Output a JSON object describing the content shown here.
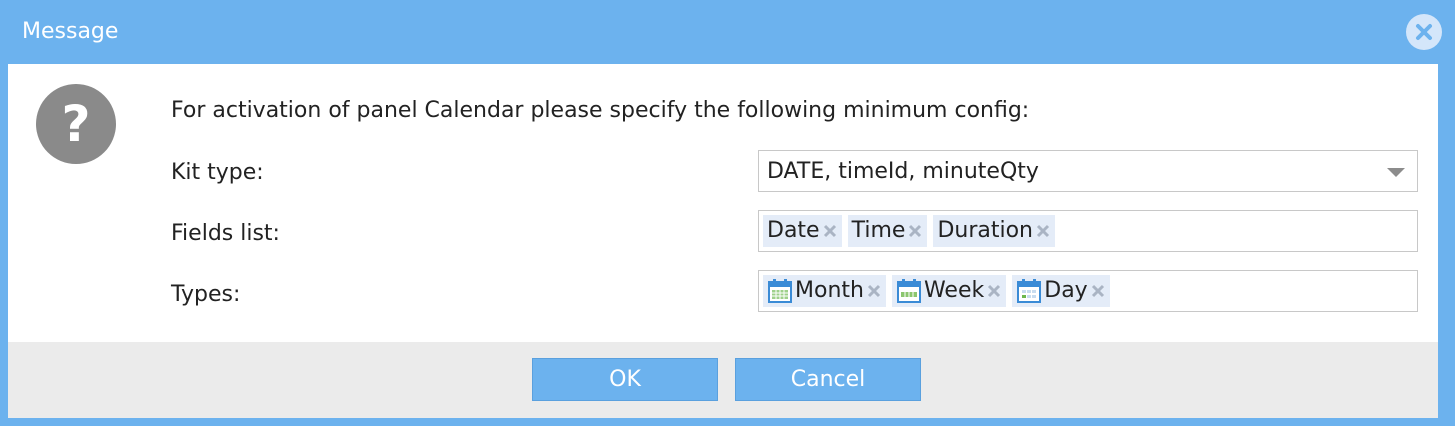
{
  "window": {
    "title": "Message"
  },
  "message": "For activation of panel Calendar please specify the following minimum config:",
  "icons": {
    "question": "question-circle-icon",
    "close": "close-circle-icon",
    "calendar": "calendar-icon",
    "remove": "x-icon"
  },
  "form": {
    "kit_type": {
      "label": "Kit type:",
      "value": "DATE, timeId, minuteQty"
    },
    "fields_list": {
      "label": "Fields list:",
      "tags": [
        "Date",
        "Time",
        "Duration"
      ]
    },
    "types": {
      "label": "Types:",
      "tags": [
        "Month",
        "Week",
        "Day"
      ]
    }
  },
  "buttons": {
    "ok": "OK",
    "cancel": "Cancel"
  },
  "colors": {
    "accent": "#6cb2ee",
    "tag_bg": "#e4ecf8",
    "footer_bg": "#ebebeb",
    "icon_gray": "#8a8a8a"
  }
}
